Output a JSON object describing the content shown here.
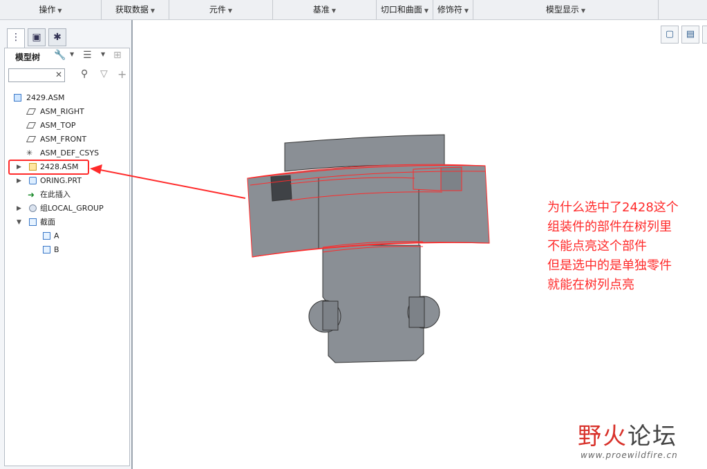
{
  "ribbon": {
    "groups": [
      {
        "label": "操作"
      },
      {
        "label": "获取数据"
      },
      {
        "label": "元件"
      },
      {
        "label": "基准"
      },
      {
        "label": "切口和曲面"
      },
      {
        "label": "修饰符"
      },
      {
        "label": "模型显示"
      }
    ]
  },
  "panel": {
    "tree_title": "模型树"
  },
  "tree": {
    "items": [
      {
        "label": "2429.ASM"
      },
      {
        "label": "ASM_RIGHT"
      },
      {
        "label": "ASM_TOP"
      },
      {
        "label": "ASM_FRONT"
      },
      {
        "label": "ASM_DEF_CSYS"
      },
      {
        "label": "2428.ASM"
      },
      {
        "label": "ORING.PRT"
      },
      {
        "label": "在此插入"
      },
      {
        "label": "组LOCAL_GROUP"
      },
      {
        "label": "截面"
      },
      {
        "label": "A"
      },
      {
        "label": "B"
      }
    ]
  },
  "annotation": {
    "lines": [
      "为什么选中了2428这个",
      "组装件的部件在树列里",
      "不能点亮这个部件",
      "但是选中的是单独零件",
      "就能在树列点亮"
    ]
  },
  "logo": {
    "cn_a": "野火",
    "cn_b": "论坛",
    "url": "www.proewildfire.cn"
  },
  "colors": {
    "annotation": "#ff2a2a",
    "model_fill": "#8a8f95",
    "edge_highlight": "#ff2a2a"
  }
}
